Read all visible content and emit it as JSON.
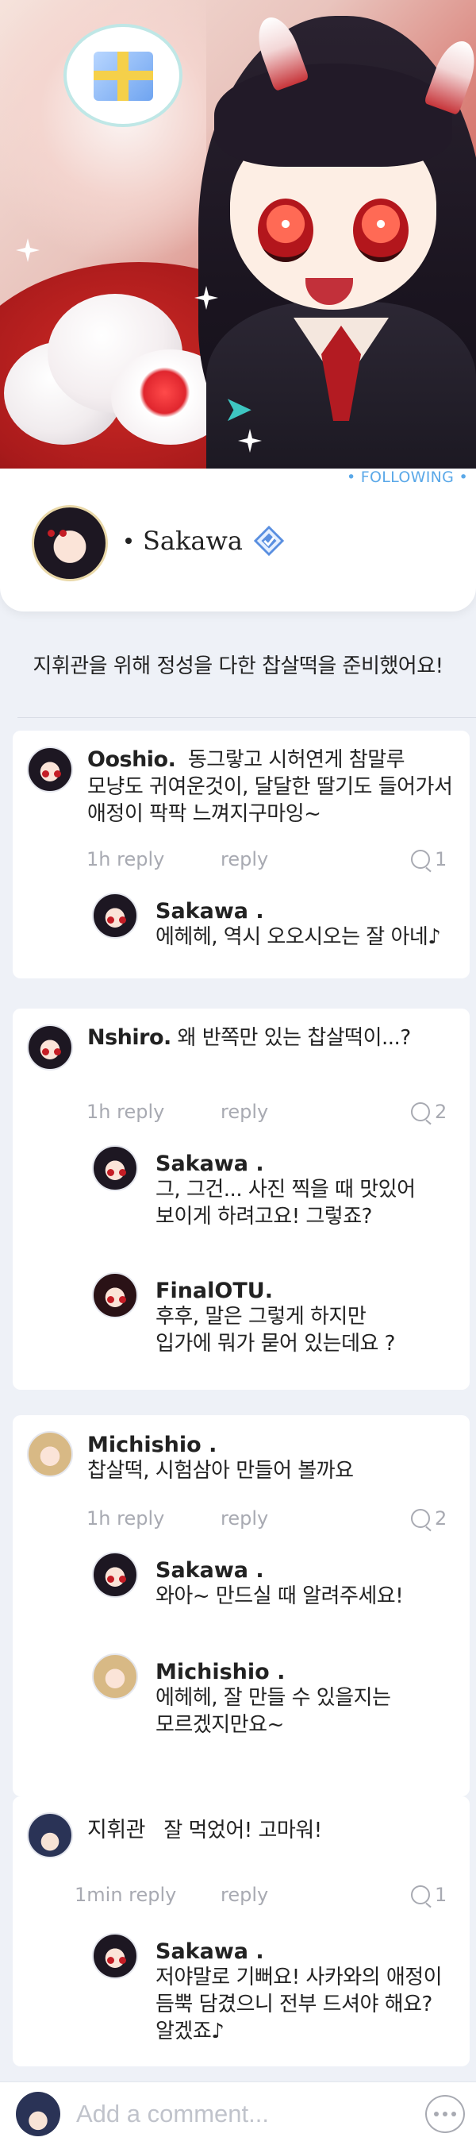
{
  "post": {
    "following_label": "• FOLLOWING •",
    "author": "Sakawa",
    "text": "지휘관을 위해 정성을 다한 찹살떡을 준비했어요!"
  },
  "comments": [
    {
      "name": "Ooshio.",
      "text_lines": [
        "동그랗고 시허연게 참말루",
        "모냥도 귀여운것이, 달달한 딸기도 들어가서",
        "애정이 팍팍 느껴지구마잉~"
      ],
      "time": "1h reply",
      "reply_label": "reply",
      "reply_count": "1",
      "replies": [
        {
          "name": "Sakawa .",
          "text_lines": [
            "에헤헤, 역시 오오시오는 잘 아네♪"
          ]
        }
      ]
    },
    {
      "name": "Nshiro.",
      "text_lines": [
        "왜 반쪽만 있는 찹살떡이...?"
      ],
      "time": "1h reply",
      "reply_label": "reply",
      "reply_count": "2",
      "replies": [
        {
          "name": "Sakawa .",
          "text_lines": [
            "그, 그건... 사진 찍을 때 맛있어",
            "보이게 하려고요! 그렇죠?"
          ]
        },
        {
          "name": "FinalOTU.",
          "text_lines": [
            "후후, 말은 그렇게 하지만",
            "입가에 뭐가 묻어 있는데요 ?"
          ]
        }
      ]
    },
    {
      "name": "Michishio .",
      "text_lines": [
        "찹살떡, 시험삼아 만들어 볼까요"
      ],
      "time": "1h reply",
      "reply_label": "reply",
      "reply_count": "2",
      "replies": [
        {
          "name": "Sakawa .",
          "text_lines": [
            "와아~ 만드실 때 알려주세요!"
          ]
        },
        {
          "name": "Michishio .",
          "text_lines": [
            "에헤헤, 잘 만들 수 있을지는",
            "모르겠지만요~"
          ]
        }
      ]
    },
    {
      "name": "지휘관",
      "text_lines": [
        "잘 먹었어! 고마워!"
      ],
      "time": "1min reply",
      "reply_label": "reply",
      "reply_count": "1",
      "replies": [
        {
          "name": "Sakawa .",
          "text_lines": [
            "저야말로 기뻐요! 사카와의 애정이",
            "듬뿍 담겼으니 전부 드셔야 해요?",
            "알겠죠♪"
          ]
        }
      ]
    }
  ],
  "composer": {
    "placeholder": "Add a comment..."
  },
  "colors": {
    "following": "#5aa8e8",
    "meta": "#a8aab2",
    "background": "#eef1f7"
  },
  "icons": [
    "gift-icon",
    "verified-badge-icon",
    "reply-bubble-icon",
    "more-dots-icon"
  ]
}
